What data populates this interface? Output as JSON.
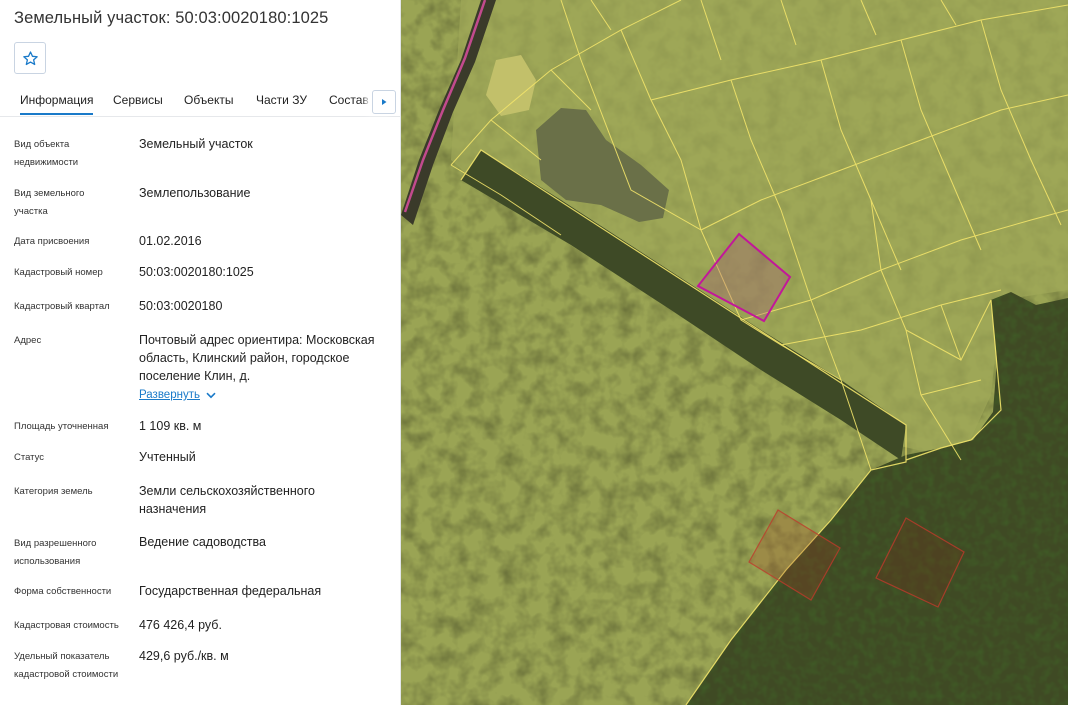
{
  "panel": {
    "title": "Земельный участок: 50:03:0020180:1025",
    "favorite_icon": "star-icon",
    "tabs": [
      "Информация",
      "Сервисы",
      "Объекты",
      "Части ЗУ",
      "Состав Е"
    ],
    "active_tab": "Информация",
    "tabs_more_icon": "triangle-right-icon",
    "rows": [
      {
        "label": "Вид объекта недвижимости",
        "value": "Земельный участок"
      },
      {
        "label": "Вид земельного участка",
        "value": "Землепользование"
      },
      {
        "label": "Дата присвоения",
        "value": "01.02.2016"
      },
      {
        "label": "Кадастровый номер",
        "value": "50:03:0020180:1025"
      },
      {
        "label": "Кадастровый квартал",
        "value": "50:03:0020180"
      },
      {
        "label": "Адрес",
        "value": "Почтовый адрес ориентира: Московская область, Клинский район, городское поселение Клин, д."
      },
      {
        "label": "Площадь уточненная",
        "value": "1 109 кв. м"
      },
      {
        "label": "Статус",
        "value": "Учтенный"
      },
      {
        "label": "Категория земель",
        "value": "Земли сельскохозяйственного назначения"
      },
      {
        "label": "Вид разрешенного использования",
        "value": "Ведение садоводства"
      },
      {
        "label": "Форма собственности",
        "value": "Государственная федеральная"
      },
      {
        "label": "Кадастровая стоимость",
        "value": "476 426,4 руб."
      },
      {
        "label": "Удельный показатель кадастровой стоимости",
        "value": "429,6 руб./кв. м"
      }
    ],
    "expand_link": "Развернуть",
    "expand_icon": "chevron-down-icon"
  },
  "colors": {
    "accent": "#1a7ac9",
    "parcel_boundary": "#f2e46a",
    "selected_parcel": "#c2179a",
    "other_parcel": "#c0392b"
  }
}
